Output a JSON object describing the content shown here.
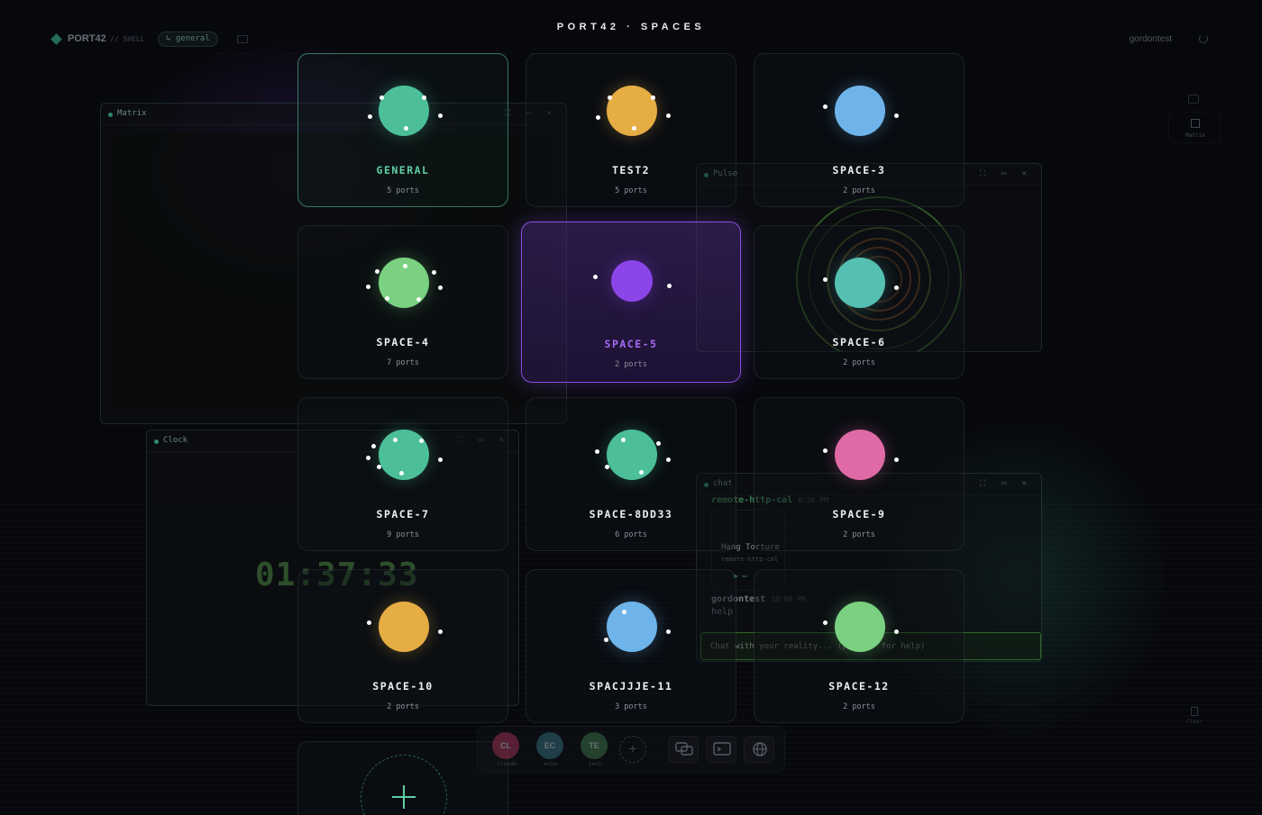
{
  "topbar": {
    "brand": "PORT42",
    "shell": "// SHELL",
    "channel": "↳ general",
    "user": "gordontest"
  },
  "overlay": {
    "title": "PORT42 · SPACES"
  },
  "spaces": [
    {
      "name": "GENERAL",
      "ports": "5 ports",
      "color": "#4cbf98"
    },
    {
      "name": "TEST2",
      "ports": "5 ports",
      "color": "#e6ad45"
    },
    {
      "name": "SPACE-3",
      "ports": "2 ports",
      "color": "#6eb4ea"
    },
    {
      "name": "SPACE-4",
      "ports": "7 ports",
      "color": "#7ad181"
    },
    {
      "name": "SPACE-5",
      "ports": "2 ports",
      "color": "#8b45e8"
    },
    {
      "name": "SPACE-6",
      "ports": "2 ports",
      "color": "#55c0b2"
    },
    {
      "name": "SPACE-7",
      "ports": "9 ports",
      "color": "#4cbf98"
    },
    {
      "name": "SPACE-8DD33",
      "ports": "6 ports",
      "color": "#4cbf98"
    },
    {
      "name": "SPACE-9",
      "ports": "2 ports",
      "color": "#e06aa6"
    },
    {
      "name": "SPACE-10",
      "ports": "2 ports",
      "color": "#e6ad45"
    },
    {
      "name": "SPACJJJE-11",
      "ports": "3 ports",
      "color": "#6eb4ea"
    },
    {
      "name": "SPACE-12",
      "ports": "2 ports",
      "color": "#7ad181"
    }
  ],
  "windows": {
    "matrix": {
      "title": "Matrix",
      "controls": "⛶ ▭ ✕"
    },
    "pulse": {
      "title": "Pulse",
      "controls": "⛶ ▭ ✕"
    },
    "clock": {
      "title": "Clock",
      "controls": "⛶ ▭ ✕",
      "time": "01:37:33"
    },
    "chat": {
      "title": "chat",
      "controls": "⛶ ▭ ✕",
      "sender1": "remote-http-cal",
      "time1": "8:56 PM",
      "card_title": "Hang Torture",
      "card_sub": "remote-http-cal",
      "card_icons": "▶     ▭",
      "sender2": "gordontest",
      "time2": "10:09 PM",
      "message": "help",
      "input_placeholder": "Chat with your reality... (press / for help)"
    }
  },
  "right_dock": {
    "matrix_label": "Matrix",
    "clear_label": "Clear"
  },
  "dock": {
    "agents": [
      {
        "initials": "CL",
        "name": "claude",
        "color": "#7a2a44"
      },
      {
        "initials": "EC",
        "name": "echo",
        "color": "#2a5560"
      },
      {
        "initials": "TE",
        "name": "test",
        "color": "#2f5a3a"
      }
    ],
    "add_label": "+"
  },
  "accent": "#8b45e8",
  "icons": [
    "brand-diamond-icon",
    "power-icon",
    "chat-icon",
    "terminal-icon",
    "globe-icon",
    "plus-icon"
  ]
}
